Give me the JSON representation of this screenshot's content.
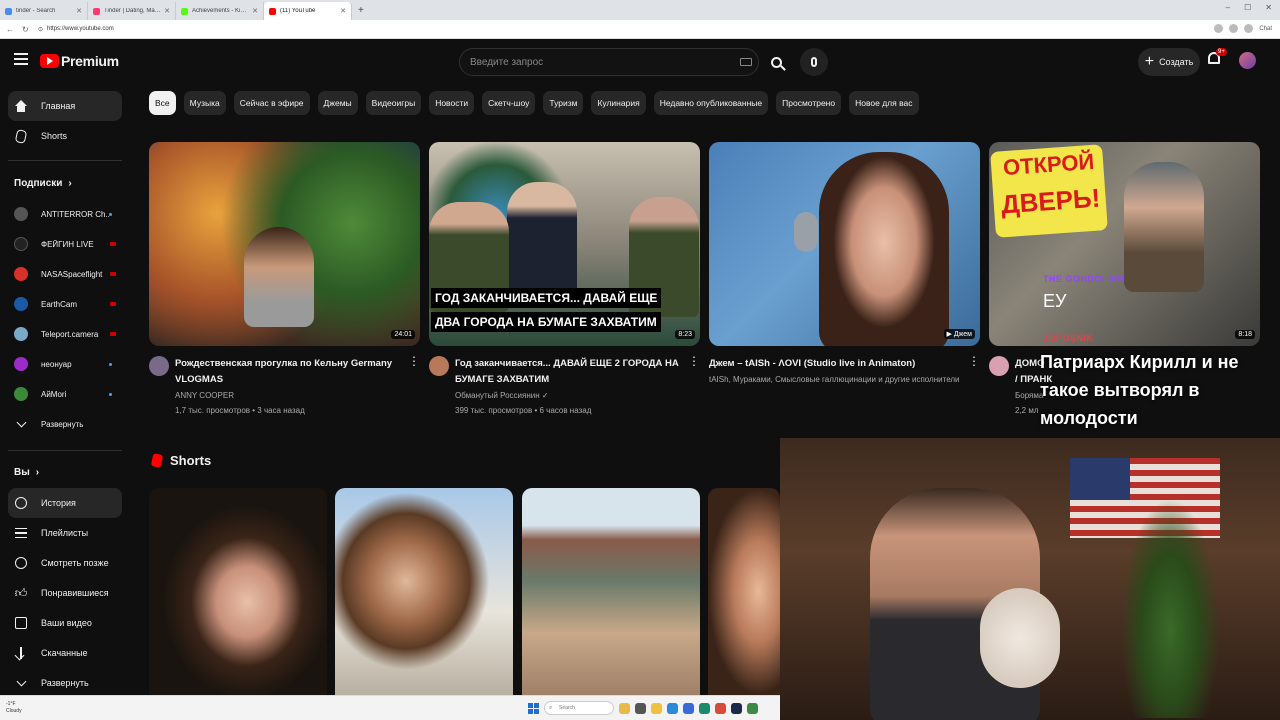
{
  "browser": {
    "tabs": [
      {
        "title": "tinder - Search",
        "color": "#4a8af4"
      },
      {
        "title": "Tinder | Dating, Make Friends & Si",
        "color": "#fe3c72"
      },
      {
        "title": "Achievements - Kick Dashboard",
        "color": "#53fc18"
      },
      {
        "title": "(11) YouTube",
        "color": "#ff0000"
      }
    ],
    "new_tab": "+",
    "url": "https://www.youtube.com",
    "profile_label": "Chat",
    "win_min": "–",
    "win_max": "☐",
    "win_close": "✕"
  },
  "header": {
    "logo_text": "Premium",
    "search_placeholder": "Введите запрос",
    "create_label": "Создать",
    "notif_count": "9+"
  },
  "sidebar": {
    "main": [
      {
        "label": "Главная",
        "icon": "home-icon"
      },
      {
        "label": "Shorts",
        "icon": "shorts-icon"
      }
    ],
    "subs_heading": "Подписки",
    "subscriptions": [
      {
        "label": "ANTITERROR Ch...",
        "status": "new",
        "color": "#555555"
      },
      {
        "label": "ФЕЙГИН LIVE",
        "status": "live",
        "color": "#222222"
      },
      {
        "label": "NASASpaceflight",
        "status": "live",
        "color": "#d6312b"
      },
      {
        "label": "EarthCam",
        "status": "live",
        "color": "#1c5aa8"
      },
      {
        "label": "Teleport.camera",
        "status": "live",
        "color": "#7aa9c8"
      },
      {
        "label": "неонуар",
        "status": "new",
        "color": "#9b2cc9"
      },
      {
        "label": "АйМori",
        "status": "new",
        "color": "#3a8a3a"
      }
    ],
    "expand_label": "Развернуть",
    "you_heading": "Вы",
    "you_items": [
      {
        "label": "История",
        "icon": "history-icon"
      },
      {
        "label": "Плейлисты",
        "icon": "playlist-icon"
      },
      {
        "label": "Смотреть позже",
        "icon": "clock-icon"
      },
      {
        "label": "Понравившиеся",
        "icon": "like-icon"
      },
      {
        "label": "Ваши видео",
        "icon": "video-icon"
      },
      {
        "label": "Скачанные",
        "icon": "download-icon"
      },
      {
        "label": "Развернуть",
        "icon": "chevron-down-icon"
      }
    ]
  },
  "chips": [
    "Все",
    "Музыка",
    "Сейчас в эфире",
    "Джемы",
    "Видеоигры",
    "Новости",
    "Скетч-шоу",
    "Туризм",
    "Кулинария",
    "Недавно опубликованные",
    "Просмотрено",
    "Новое для вас"
  ],
  "videos": [
    {
      "title": "Рождественская прогулка по Кельну Germany VLOGMAS",
      "channel": "ANNY COOPER",
      "stats": "1,7 тыс. просмотров • 3 часа назад",
      "duration": "24:01"
    },
    {
      "title": "Год заканчивается... ДАВАЙ ЕЩЕ 2 ГОРОДА НА БУМАГЕ ЗАХВАТИМ",
      "channel": "Обманутый Россиянин ✓",
      "stats": "399 тыс. просмотров • 6 часов назад",
      "duration": "8:23",
      "caption1": "ГОД ЗАКАНЧИВАЕТСЯ... ДАВАЙ ЕЩЕ",
      "caption2": "ДВА ГОРОДА НА БУМАГЕ ЗАХВАТИМ"
    },
    {
      "title": "Джем – tAISh - ΛOVI (Studio live in Animaton)",
      "channel": "tAISh, Мураками, Смысловые галлюцинации и другие исполнители",
      "stats": "",
      "duration": "▶ Джем"
    },
    {
      "title": "ДОМО",
      "channel": "Боряма",
      "stats": "2,2 мл",
      "duration": "8:18",
      "caption1": "ОТКРОЙ",
      "caption2": "ДВЕРЬ!",
      "extra": "/ ПРАНК"
    }
  ],
  "shorts_heading": "Shorts",
  "overlay": {
    "chat": [
      {
        "name": "THE GONDOLIER",
        "msg": "ЕУ"
      },
      {
        "name": "JOPOSNIK",
        "msg": ""
      }
    ],
    "big_text": "Патриарх Кирилл и не такое вытворял в молодости"
  },
  "taskbar": {
    "weather_temp": "-1°F",
    "weather_desc": "Cloudy",
    "search_placeholder": "Search"
  }
}
